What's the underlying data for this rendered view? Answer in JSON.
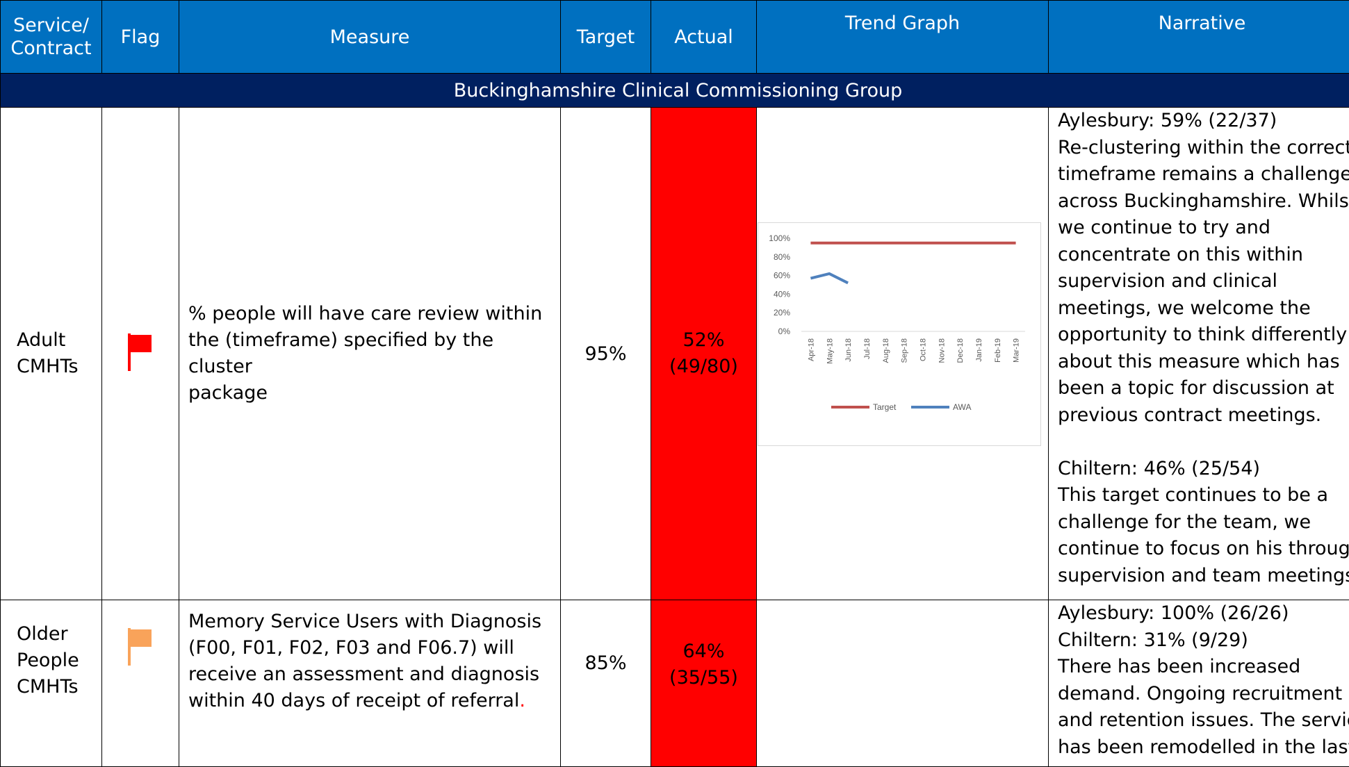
{
  "header": {
    "service": "Service/ Contract",
    "flag": "Flag",
    "measure": "Measure",
    "target": "Target",
    "actual": "Actual",
    "trend": "Trend Graph",
    "narrative": "Narrative"
  },
  "group_title": "Buckinghamshire Clinical Commissioning Group",
  "colors": {
    "header_blue": "#0070c0",
    "group_navy": "#002060",
    "actual_red": "#ff0000",
    "flag_red": "#ff0000",
    "flag_amber": "#f9a35a",
    "target_line": "#c0504d",
    "awa_line": "#4f81bd"
  },
  "rows": [
    {
      "service": [
        "Adult",
        "CMHTs"
      ],
      "flag_icon": "red-flag-icon",
      "measure": [
        "% people will have care review within",
        "the (timeframe) specified by the cluster",
        "package"
      ],
      "target": "95%",
      "actual_pct": "52%",
      "actual_ratio": "(49/80)",
      "narrative": [
        "Aylesbury: 59% (22/37)",
        "Re-clustering within the correct",
        "timeframe remains a challenge",
        "across Buckinghamshire. Whilst",
        "we continue to try and",
        "concentrate on this within",
        "supervision and clinical",
        "meetings, we welcome the",
        "opportunity to think differently",
        "about this measure which has",
        "been a topic for discussion at",
        "previous contract meetings.",
        "",
        "Chiltern: 46% (25/54)",
        "This target continues to be a",
        "challenge for the team, we",
        "continue to focus on his through",
        "supervision and team meetings."
      ]
    },
    {
      "service": [
        "Older",
        "People",
        "CMHTs"
      ],
      "flag_icon": "amber-flag-icon",
      "measure": [
        "Memory Service Users with Diagnosis",
        "(F00, F01, F02, F03 and F06.7) will",
        "receive an assessment and diagnosis",
        "within 40 days of receipt of referral"
      ],
      "measure_tail": ".",
      "target": "85%",
      "actual_pct": "64%",
      "actual_ratio": "(35/55)",
      "narrative": [
        "Aylesbury: 100% (26/26)",
        "Chiltern: 31% (9/29)",
        "There has been increased",
        "demand. Ongoing recruitment",
        "and retention issues. The service",
        "has been remodelled in the last"
      ]
    }
  ],
  "chart_data": {
    "type": "line",
    "x": [
      "Apr-18",
      "May-18",
      "Jun-18",
      "Jul-18",
      "Aug-18",
      "Sep-18",
      "Oct-18",
      "Nov-18",
      "Dec-18",
      "Jan-19",
      "Feb-19",
      "Mar-19"
    ],
    "y_ticks": [
      "100%",
      "80%",
      "60%",
      "40%",
      "20%",
      "0%"
    ],
    "ylim": [
      0,
      100
    ],
    "series": [
      {
        "name": "Target",
        "values": [
          95,
          95,
          95,
          95,
          95,
          95,
          95,
          95,
          95,
          95,
          95,
          95
        ]
      },
      {
        "name": "AWA",
        "values": [
          57,
          62,
          52,
          null,
          null,
          null,
          null,
          null,
          null,
          null,
          null,
          null
        ]
      }
    ],
    "legend": "bottom"
  }
}
